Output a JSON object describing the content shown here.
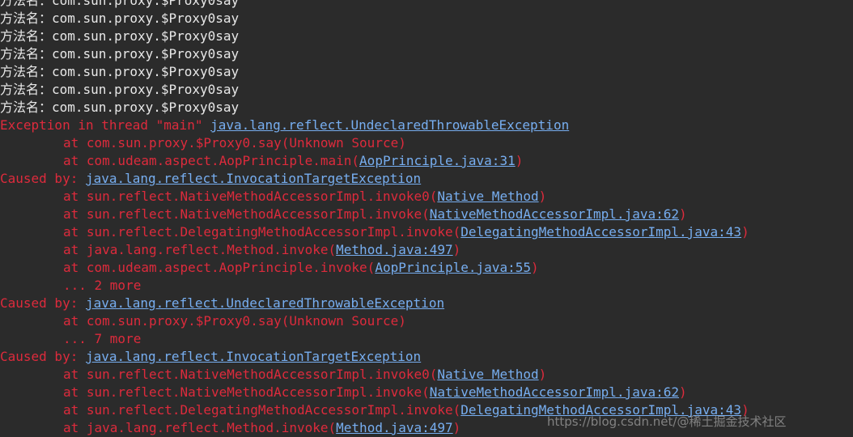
{
  "console": {
    "stdout_lines": [
      "方法名：com.sun.proxy.$Proxy0say",
      "方法名：com.sun.proxy.$Proxy0say",
      "方法名：com.sun.proxy.$Proxy0say",
      "方法名：com.sun.proxy.$Proxy0say",
      "方法名：com.sun.proxy.$Proxy0say",
      "方法名：com.sun.proxy.$Proxy0say",
      "方法名：com.sun.proxy.$Proxy0say"
    ],
    "exception": {
      "prefix": "Exception in thread \"main\" ",
      "link": "java.lang.reflect.UndeclaredThrowableException"
    },
    "trace1": [
      {
        "text": "at com.sun.proxy.$Proxy0.say(Unknown Source)",
        "link": "",
        "suffix": ""
      },
      {
        "text": "at com.udeam.aspect.AopPrinciple.main(",
        "link": "AopPrinciple.java:31",
        "suffix": ")"
      }
    ],
    "caused1": {
      "prefix": "Caused by: ",
      "link": "java.lang.reflect.InvocationTargetException"
    },
    "trace2": [
      {
        "text": "at sun.reflect.NativeMethodAccessorImpl.invoke0(",
        "link": "Native Method",
        "suffix": ")"
      },
      {
        "text": "at sun.reflect.NativeMethodAccessorImpl.invoke(",
        "link": "NativeMethodAccessorImpl.java:62",
        "suffix": ")"
      },
      {
        "text": "at sun.reflect.DelegatingMethodAccessorImpl.invoke(",
        "link": "DelegatingMethodAccessorImpl.java:43",
        "suffix": ")"
      },
      {
        "text": "at java.lang.reflect.Method.invoke(",
        "link": "Method.java:497",
        "suffix": ")"
      },
      {
        "text": "at com.udeam.aspect.AopPrinciple.invoke(",
        "link": "AopPrinciple.java:55",
        "suffix": ")"
      }
    ],
    "more1": "... 2 more",
    "caused2": {
      "prefix": "Caused by: ",
      "link": "java.lang.reflect.UndeclaredThrowableException"
    },
    "trace3": [
      {
        "text": "at com.sun.proxy.$Proxy0.say(Unknown Source)",
        "link": "",
        "suffix": ""
      }
    ],
    "more2": "... 7 more",
    "caused3": {
      "prefix": "Caused by: ",
      "link": "java.lang.reflect.InvocationTargetException"
    },
    "trace4": [
      {
        "text": "at sun.reflect.NativeMethodAccessorImpl.invoke0(",
        "link": "Native Method",
        "suffix": ")"
      },
      {
        "text": "at sun.reflect.NativeMethodAccessorImpl.invoke(",
        "link": "NativeMethodAccessorImpl.java:62",
        "suffix": ")"
      },
      {
        "text": "at sun.reflect.DelegatingMethodAccessorImpl.invoke(",
        "link": "DelegatingMethodAccessorImpl.java:43",
        "suffix": ")"
      },
      {
        "text": "at java.lang.reflect.Method.invoke(",
        "link": "Method.java:497",
        "suffix": ")"
      }
    ]
  },
  "watermark": "https://blog.csdn.net/@稀土掘金技术社区",
  "colors": {
    "background": "#2b2b2b",
    "stdout": "#e8e8e8",
    "stderr": "#dd2b3c",
    "link": "#77aef0"
  }
}
